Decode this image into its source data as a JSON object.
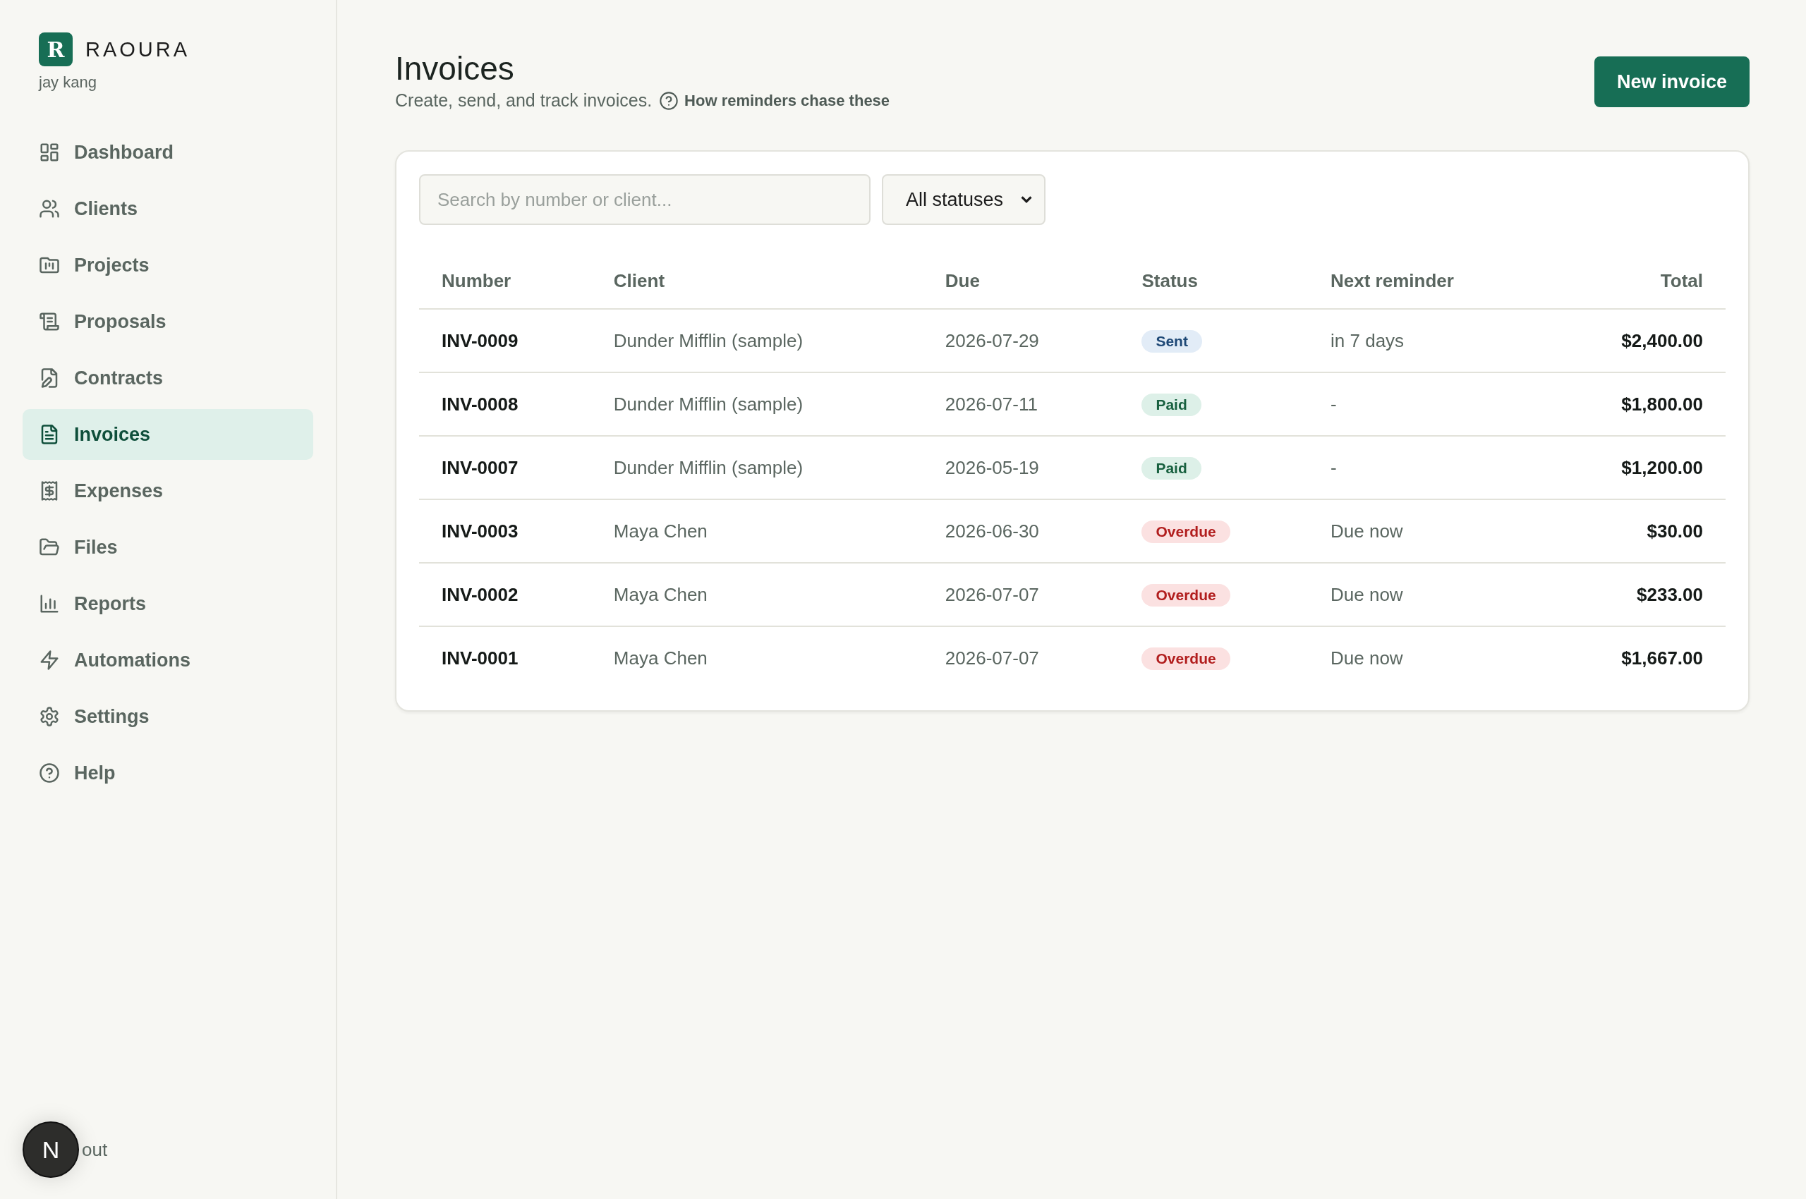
{
  "brand": {
    "logo": "R",
    "name": "RAOURA",
    "user": "jay kang"
  },
  "nav": [
    {
      "label": "Dashboard",
      "selected": false
    },
    {
      "label": "Clients",
      "selected": false
    },
    {
      "label": "Projects",
      "selected": false
    },
    {
      "label": "Proposals",
      "selected": false
    },
    {
      "label": "Contracts",
      "selected": false
    },
    {
      "label": "Invoices",
      "selected": true
    },
    {
      "label": "Expenses",
      "selected": false
    },
    {
      "label": "Files",
      "selected": false
    },
    {
      "label": "Reports",
      "selected": false
    },
    {
      "label": "Automations",
      "selected": false
    },
    {
      "label": "Settings",
      "selected": false
    },
    {
      "label": "Help",
      "selected": false
    }
  ],
  "sign_out": {
    "avatar": "N",
    "label": "out"
  },
  "header": {
    "title": "Invoices",
    "subtitle": "Create, send, and track invoices.",
    "help_link": "How reminders chase these",
    "button": "New invoice"
  },
  "filters": {
    "search_placeholder": "Search by number or client...",
    "status_select": "All statuses"
  },
  "table": {
    "columns": [
      "Number",
      "Client",
      "Due",
      "Status",
      "Next reminder",
      "Total"
    ],
    "rows": [
      {
        "number": "INV-0009",
        "client": "Dunder Mifflin (sample)",
        "due": "2026-07-29",
        "status": {
          "label": "Sent",
          "kind": "sent"
        },
        "next_reminder": "in 7 days",
        "total": "$2,400.00"
      },
      {
        "number": "INV-0008",
        "client": "Dunder Mifflin (sample)",
        "due": "2026-07-11",
        "status": {
          "label": "Paid",
          "kind": "paid"
        },
        "next_reminder": "-",
        "total": "$1,800.00"
      },
      {
        "number": "INV-0007",
        "client": "Dunder Mifflin (sample)",
        "due": "2026-05-19",
        "status": {
          "label": "Paid",
          "kind": "paid"
        },
        "next_reminder": "-",
        "total": "$1,200.00"
      },
      {
        "number": "INV-0003",
        "client": "Maya Chen",
        "due": "2026-06-30",
        "status": {
          "label": "Overdue",
          "kind": "overdue"
        },
        "next_reminder": "Due now",
        "total": "$30.00"
      },
      {
        "number": "INV-0002",
        "client": "Maya Chen",
        "due": "2026-07-07",
        "status": {
          "label": "Overdue",
          "kind": "overdue"
        },
        "next_reminder": "Due now",
        "total": "$233.00"
      },
      {
        "number": "INV-0001",
        "client": "Maya Chen",
        "due": "2026-07-07",
        "status": {
          "label": "Overdue",
          "kind": "overdue"
        },
        "next_reminder": "Due now",
        "total": "$1,667.00"
      }
    ]
  }
}
